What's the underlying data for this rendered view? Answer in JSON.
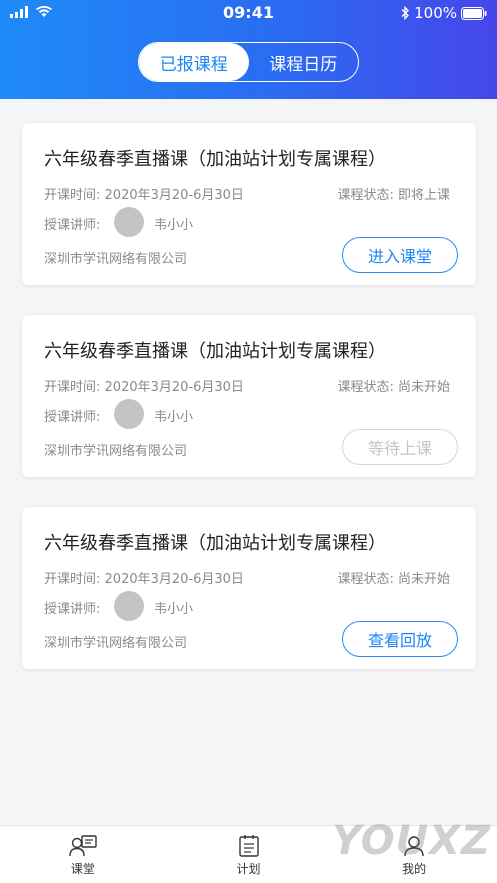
{
  "status_bar": {
    "time": "09:41",
    "battery": "100%"
  },
  "segment": {
    "active": "已报课程",
    "other": "课程日历"
  },
  "cards": [
    {
      "title": "六年级春季直播课（加油站计划专属课程）",
      "date_label": "开课时间:",
      "date": "2020年3月20-6月30日",
      "status_label": "课程状态:",
      "status": "即将上课",
      "teacher_label": "授课讲师:",
      "teacher": "韦小小",
      "company": "深圳市学讯网络有限公司",
      "button": "进入课堂"
    },
    {
      "title": "六年级春季直播课（加油站计划专属课程）",
      "date_label": "开课时间:",
      "date": "2020年3月20-6月30日",
      "status_label": "课程状态:",
      "status": "尚未开始",
      "teacher_label": "授课讲师:",
      "teacher": "韦小小",
      "company": "深圳市学讯网络有限公司",
      "button": "等待上课"
    },
    {
      "title": "六年级春季直播课（加油站计划专属课程）",
      "date_label": "开课时间:",
      "date": "2020年3月20-6月30日",
      "status_label": "课程状态:",
      "status": "尚未开始",
      "teacher_label": "授课讲师:",
      "teacher": "韦小小",
      "company": "深圳市学讯网络有限公司",
      "button": "查看回放"
    }
  ],
  "tabbar": {
    "tab1": "课堂",
    "tab2": "计划",
    "tab3": "我的"
  },
  "watermark": "YOUXZ",
  "colors": {
    "accent": "#1e86f4",
    "gradient_start": "#1e8bf7",
    "gradient_end": "#4646ea"
  }
}
